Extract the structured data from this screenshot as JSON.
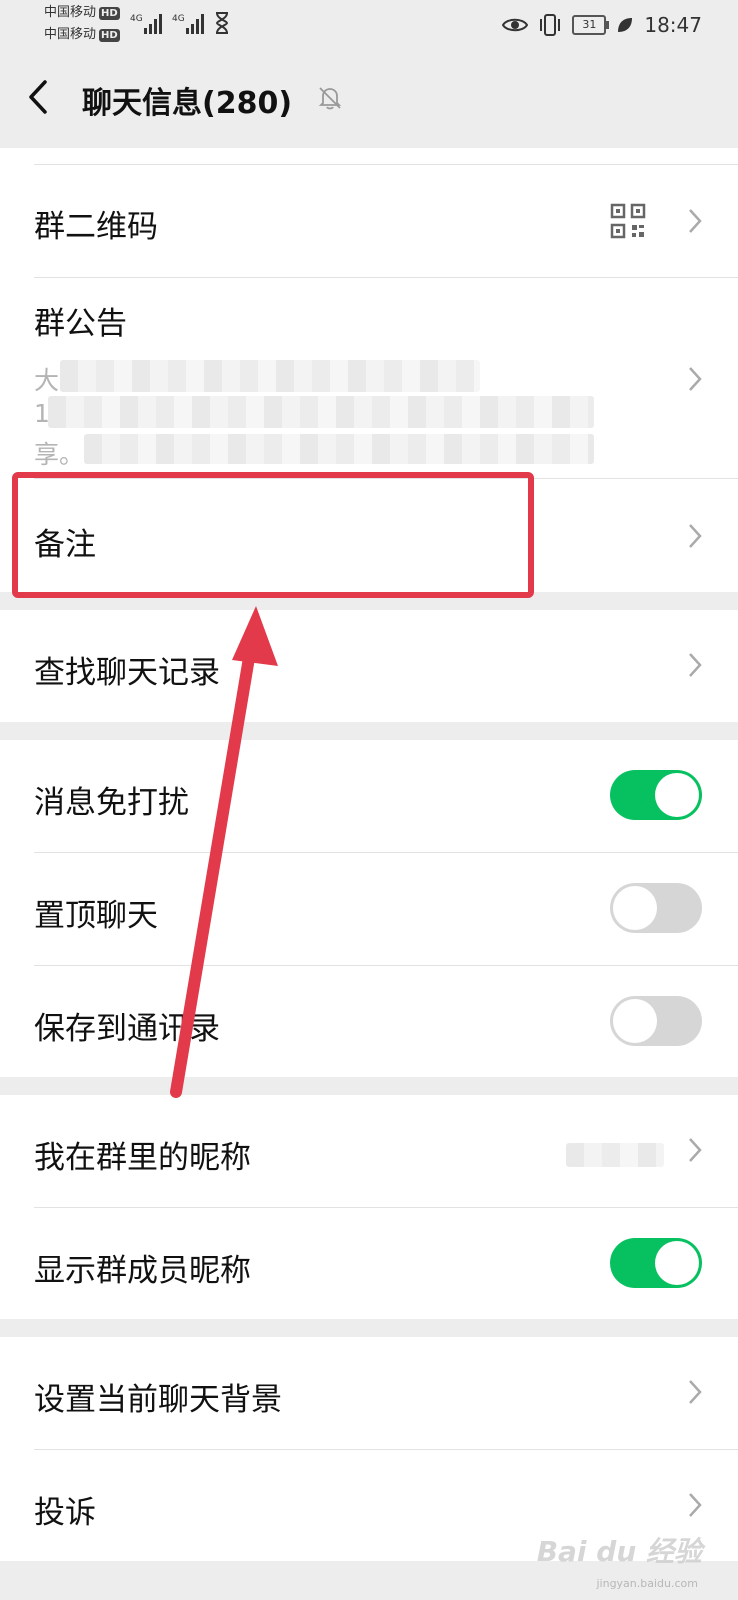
{
  "status_bar": {
    "carrier_1": "中国移动",
    "carrier_2": "中国移动",
    "hd_badge": "HD",
    "network_1": "4G",
    "network_2": "4G",
    "battery": "31",
    "time": "18:47"
  },
  "nav": {
    "title": "聊天信息(280)"
  },
  "rows": {
    "qr_code": "群二维码",
    "announcement": "群公告",
    "announcement_visible_1": "大",
    "announcement_visible_2": "1",
    "announcement_visible_3": "享。",
    "remark": "备注",
    "search_history": "查找聊天记录",
    "mute": "消息免打扰",
    "sticky": "置顶聊天",
    "save_contacts": "保存到通讯录",
    "my_nickname": "我在群里的昵称",
    "show_nicknames": "显示群成员昵称",
    "chat_background": "设置当前聊天背景",
    "report": "投诉"
  },
  "toggles": {
    "mute": true,
    "sticky": false,
    "save_contacts": false,
    "show_nicknames": true
  },
  "colors": {
    "toggle_on": "#07c160",
    "toggle_off": "#d6d6d6",
    "annotation": "#e23a4a"
  },
  "watermark": {
    "brand": "Bai du 经验",
    "url": "jingyan.baidu.com"
  }
}
